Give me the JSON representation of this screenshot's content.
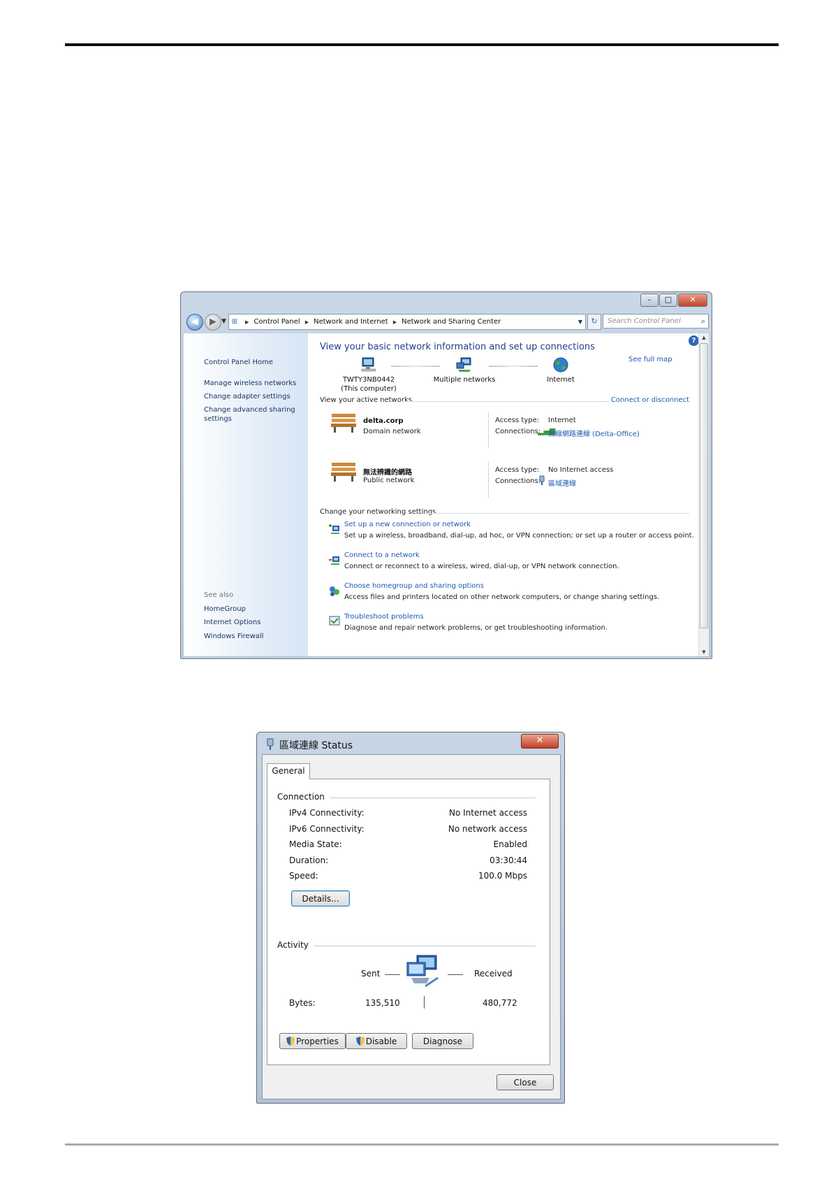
{
  "network_center": {
    "caption_buttons": {
      "minimize": "–",
      "maximize": "□",
      "close": "✕"
    },
    "breadcrumb": [
      "Control Panel",
      "Network and Internet",
      "Network and Sharing Center"
    ],
    "search_placeholder": "Search Control Panel",
    "sidebar": {
      "home": "Control Panel Home",
      "links": [
        "Manage wireless networks",
        "Change adapter settings",
        "Change advanced sharing",
        "settings"
      ],
      "see_also_heading": "See also",
      "see_also": [
        "HomeGroup",
        "Internet Options",
        "Windows Firewall"
      ]
    },
    "title": "View your basic network information and set up connections",
    "see_full_map": "See full map",
    "map": {
      "computer_name": "TWTY3NB0442",
      "computer_note": "(This computer)",
      "middle": "Multiple networks",
      "internet": "Internet"
    },
    "active_heading": "View your active networks",
    "connect_link": "Connect or disconnect",
    "networks": [
      {
        "name": "delta.corp",
        "type": "Domain network",
        "access_label": "Access type:",
        "access": "Internet",
        "conn_label": "Connections:",
        "connection": "無線網路連線 (Delta-Office)"
      },
      {
        "name": "無法辨識的網路",
        "type": "Public network",
        "access_label": "Access type:",
        "access": "No Internet access",
        "conn_label": "Connections:",
        "connection": "區域連線"
      }
    ],
    "settings_heading": "Change your networking settings",
    "tasks": [
      {
        "title": "Set up a new connection or network",
        "desc": "Set up a wireless, broadband, dial-up, ad hoc, or VPN connection; or set up a router or access point."
      },
      {
        "title": "Connect to a network",
        "desc": "Connect or reconnect to a wireless, wired, dial-up, or VPN network connection."
      },
      {
        "title": "Choose homegroup and sharing options",
        "desc": "Access files and printers located on other network computers, or change sharing settings."
      },
      {
        "title": "Troubleshoot problems",
        "desc": "Diagnose and repair network problems, or get troubleshooting information."
      }
    ]
  },
  "status_dialog": {
    "title": "區域連線 Status",
    "close_glyph": "✕",
    "tab": "General",
    "connection_heading": "Connection",
    "rows": [
      {
        "label": "IPv4 Connectivity:",
        "value": "No Internet access"
      },
      {
        "label": "IPv6 Connectivity:",
        "value": "No network access"
      },
      {
        "label": "Media State:",
        "value": "Enabled"
      },
      {
        "label": "Duration:",
        "value": "03:30:44"
      },
      {
        "label": "Speed:",
        "value": "100.0 Mbps"
      }
    ],
    "details_button": "Details...",
    "activity_heading": "Activity",
    "sent_label": "Sent",
    "received_label": "Received",
    "bytes_label": "Bytes:",
    "bytes_sent": "135,510",
    "bytes_received": "480,772",
    "properties_button": "Properties",
    "disable_button": "Disable",
    "diagnose_button": "Diagnose",
    "close_button": "Close"
  }
}
